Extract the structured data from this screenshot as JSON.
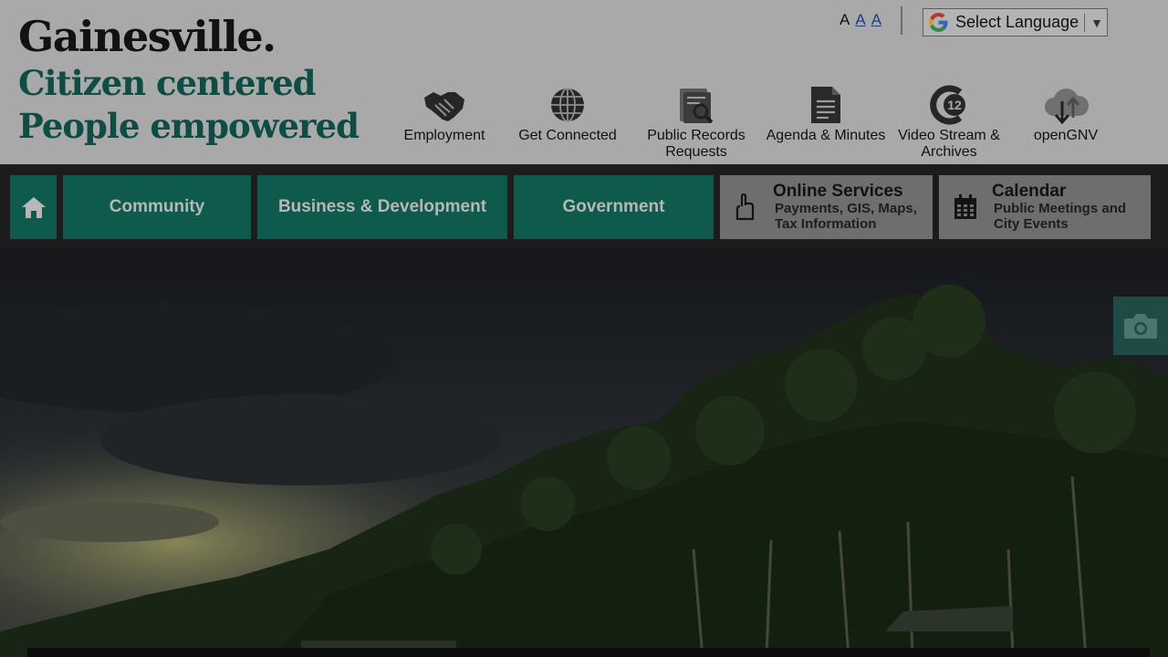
{
  "brand": {
    "name": "Gainesville.",
    "tagline_1": "Citizen centered",
    "tagline_2": "People empowered"
  },
  "text_size": {
    "small": "A",
    "medium": "A",
    "large": "A"
  },
  "language": {
    "label": "Select Language",
    "arrow": "▼"
  },
  "quick_links": [
    {
      "label": "Employment",
      "icon": "handshake-icon"
    },
    {
      "label": "Get Connected",
      "icon": "globe-icon"
    },
    {
      "label": "Public Records Requests",
      "icon": "records-search-icon"
    },
    {
      "label": "Agenda & Minutes",
      "icon": "document-icon"
    },
    {
      "label": "Video Stream & Archives",
      "icon": "channel-12-icon"
    },
    {
      "label": "openGNV",
      "icon": "cloud-download-icon"
    }
  ],
  "nav": {
    "home_icon": "home-icon",
    "community": "Community",
    "business": "Business & Development",
    "government": "Government",
    "online_services": {
      "title": "Online Services",
      "subtitle": "Payments, GIS, Maps, Tax Information",
      "icon": "hand-pointer-icon"
    },
    "calendar": {
      "title": "Calendar",
      "subtitle": "Public Meetings and City Events",
      "icon": "calendar-icon"
    }
  },
  "hero": {
    "camera_icon": "camera-icon"
  },
  "colors": {
    "header_bg": "#a9a9a9",
    "brand_green": "#0e4d43",
    "nav_green": "#0e5a4d",
    "nav_grey": "#6e6e6e"
  }
}
